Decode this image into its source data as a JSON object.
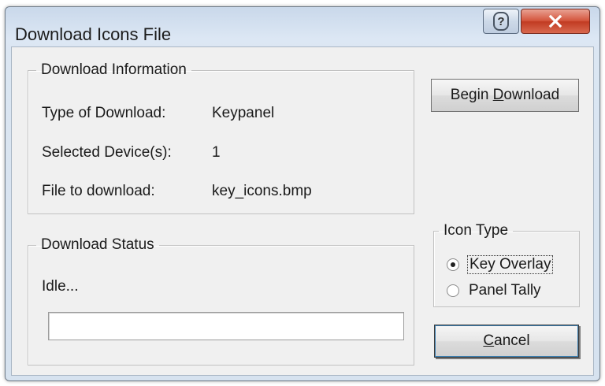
{
  "window": {
    "title": "Download Icons File"
  },
  "download_info": {
    "legend": "Download Information",
    "rows": [
      {
        "label": "Type of Download:",
        "value": "Keypanel"
      },
      {
        "label": "Selected Device(s):",
        "value": "1"
      },
      {
        "label": "File to download:",
        "value": "key_icons.bmp"
      }
    ]
  },
  "download_status": {
    "legend": "Download Status",
    "status_text": "Idle...",
    "progress_fraction": 0
  },
  "buttons": {
    "begin_prefix": "Begin ",
    "begin_accel": "D",
    "begin_rest": "ownload",
    "cancel_accel": "C",
    "cancel_rest": "ancel"
  },
  "icon_type": {
    "legend": "Icon Type",
    "options": [
      {
        "label": "Key Overlay",
        "selected": true
      },
      {
        "label": "Panel Tally",
        "selected": false
      }
    ]
  },
  "icons": {
    "help": "help-icon",
    "close": "close-icon"
  },
  "colors": {
    "close_button": "#d4553c",
    "title_gradient": "#c9d8ea",
    "dialog_face": "#f0f0f0"
  }
}
